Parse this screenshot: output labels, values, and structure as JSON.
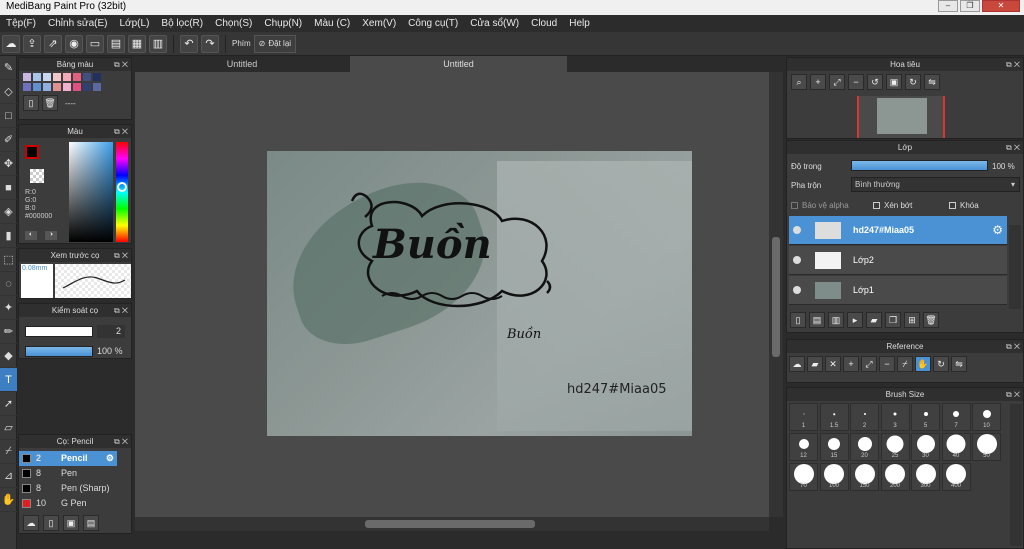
{
  "app": {
    "title": "MediBang Paint Pro (32bit)"
  },
  "menu": [
    "Tệp(F)",
    "Chỉnh sửa(E)",
    "Lớp(L)",
    "Bộ lọc(R)",
    "Chọn(S)",
    "Chụp(N)",
    "Màu (C)",
    "Xem(V)",
    "Công cụ(T)",
    "Cửa sổ(W)",
    "Cloud",
    "Help"
  ],
  "toolbar": {
    "shortcut_label": "Phím",
    "reset_label": "Đặt lại"
  },
  "panels": {
    "palette": {
      "title": "Bảng màu",
      "dash": "----",
      "colors": [
        "#c9b7e0",
        "#a8c6ec",
        "#c8d8f0",
        "#f0c8c8",
        "#f4a8b8",
        "#e06080",
        "#405080",
        "#203060",
        "#7070c0",
        "#6090d0",
        "#90b0e0",
        "#e09090",
        "#f0b0d0",
        "#e05080",
        "#304070",
        "#5a6aa0"
      ]
    },
    "color": {
      "title": "Màu",
      "r": "R:0",
      "g": "G:0",
      "b": "B:0",
      "hex": "#000000"
    },
    "brush_preview": {
      "title": "Xem trước cọ",
      "size": "0.08mm"
    },
    "brush_control": {
      "title": "Kiểm soát cọ",
      "size": "2",
      "opacity": "100 %",
      "opacity_value": 1.0
    },
    "brushes": {
      "title": "Cọ: Pencil",
      "items": [
        {
          "size": "2",
          "name": "Pencil",
          "color": "#000000"
        },
        {
          "size": "8",
          "name": "Pen",
          "color": "#000000"
        },
        {
          "size": "8",
          "name": "Pen (Sharp)",
          "color": "#000000"
        },
        {
          "size": "10",
          "name": "G Pen",
          "color": "#e02020"
        }
      ]
    },
    "navigator": {
      "title": "Hoa tiêu"
    },
    "layers": {
      "title": "Lớp",
      "opacity_label": "Độ trong",
      "opacity": "100 %",
      "opacity_value": 1.0,
      "blend_label": "Pha trộn",
      "blend": "Bình thường",
      "protect_alpha": "Bảo vệ alpha",
      "clip": "Xén bớt",
      "lock": "Khóa",
      "items": [
        "hd247#Miaa05",
        "Lớp2",
        "Lớp1"
      ]
    },
    "reference": {
      "title": "Reference"
    },
    "brush_size": {
      "title": "Brush Size",
      "sizes": [
        "1",
        "1.5",
        "2",
        "3",
        "5",
        "7",
        "10",
        "12",
        "15",
        "20",
        "25",
        "30",
        "40",
        "50",
        "70",
        "100",
        "150",
        "200",
        "300",
        "400"
      ]
    }
  },
  "tabs": [
    "Untitled",
    "Untitled"
  ],
  "canvas": {
    "word_large": "Buồn",
    "word_small": "Buồn",
    "watermark": "hd247#Miaa05"
  },
  "colors": {
    "accent": "#4a92d4",
    "background": "#2b2b2b"
  }
}
